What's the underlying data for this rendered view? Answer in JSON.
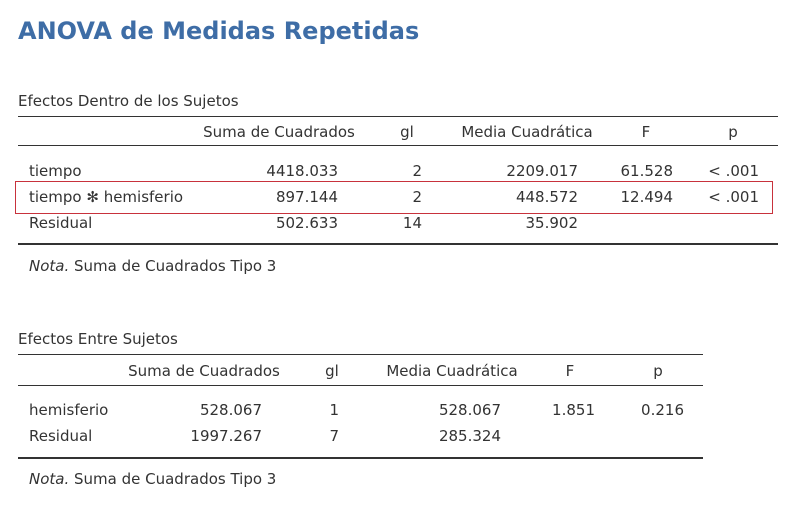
{
  "title": "ANOVA de Medidas Repetidas",
  "within": {
    "caption": "Efectos Dentro de los Sujetos",
    "headers": {
      "ss": "Suma de Cuadrados",
      "gl": "gl",
      "ms": "Media Cuadrática",
      "f": "F",
      "p": "p"
    },
    "rows": [
      {
        "label": "tiempo",
        "ss": "4418.033",
        "gl": "2",
        "ms": "2209.017",
        "f": "61.528",
        "p": "< .001"
      },
      {
        "label": "tiempo ✻ hemisferio",
        "ss": "897.144",
        "gl": "2",
        "ms": "448.572",
        "f": "12.494",
        "p": "< .001"
      },
      {
        "label": "Residual",
        "ss": "502.633",
        "gl": "14",
        "ms": "35.902",
        "f": "",
        "p": ""
      }
    ],
    "note_label": "Nota.",
    "note_text": " Suma de Cuadrados Tipo 3"
  },
  "between": {
    "caption": "Efectos Entre Sujetos",
    "headers": {
      "ss": "Suma de Cuadrados",
      "gl": "gl",
      "ms": "Media Cuadrática",
      "f": "F",
      "p": "p"
    },
    "rows": [
      {
        "label": "hemisferio",
        "ss": "528.067",
        "gl": "1",
        "ms": "528.067",
        "f": "1.851",
        "p": "0.216"
      },
      {
        "label": "Residual",
        "ss": "1997.267",
        "gl": "7",
        "ms": "285.324",
        "f": "",
        "p": ""
      }
    ],
    "note_label": "Nota.",
    "note_text": " Suma de Cuadrados Tipo 3"
  },
  "colors": {
    "title": "#3e6da6",
    "highlight_border": "#c8323c",
    "text": "#333333"
  }
}
